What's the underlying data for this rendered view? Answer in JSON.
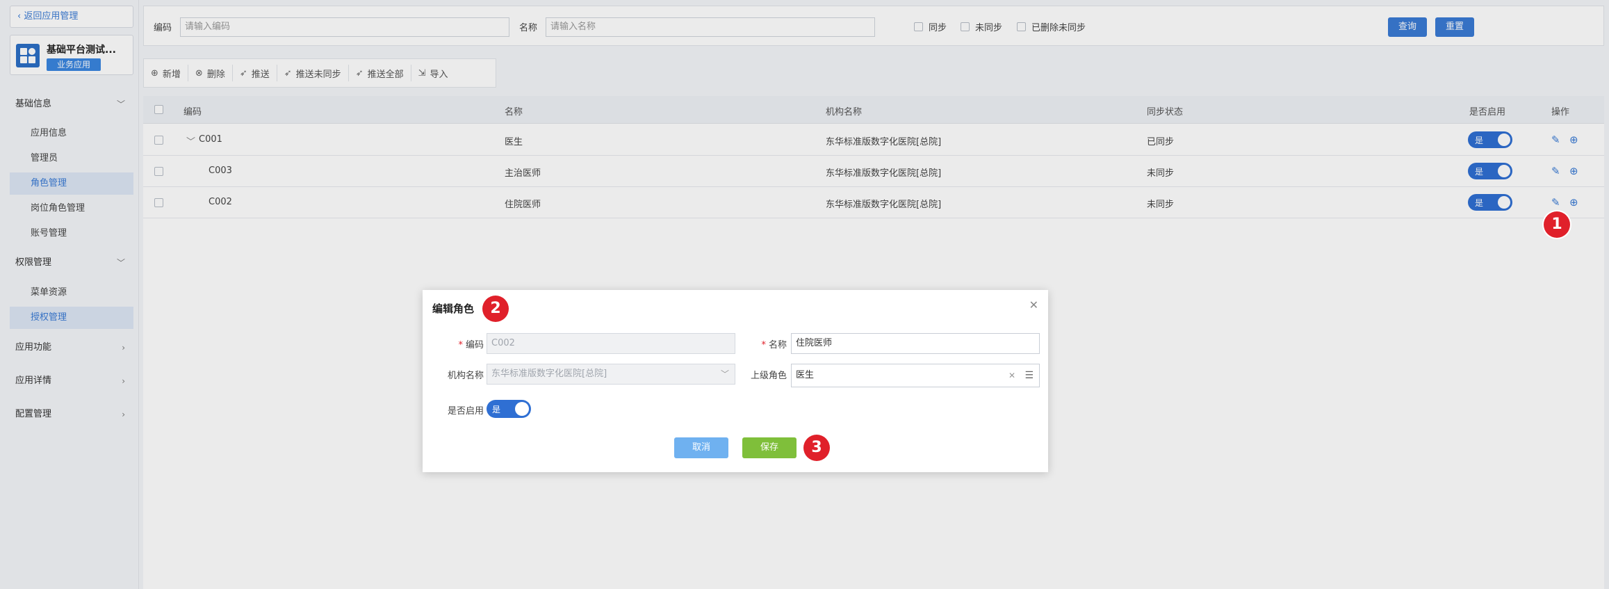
{
  "sidebar": {
    "back_label": "返回应用管理",
    "app_name": "基础平台测试...",
    "app_tag": "业务应用",
    "groups": [
      {
        "label": "基础信息",
        "items": [
          "应用信息",
          "管理员",
          "角色管理",
          "岗位角色管理",
          "账号管理"
        ]
      },
      {
        "label": "权限管理",
        "items": [
          "菜单资源",
          "授权管理"
        ]
      },
      {
        "label": "应用功能",
        "items": []
      },
      {
        "label": "应用详情",
        "items": []
      },
      {
        "label": "配置管理",
        "items": []
      }
    ]
  },
  "search": {
    "code_label": "编码",
    "code_placeholder": "请输入编码",
    "name_label": "名称",
    "name_placeholder": "请输入名称",
    "filters": [
      "同步",
      "未同步",
      "已删除未同步"
    ],
    "query_label": "查询",
    "reset_label": "重置"
  },
  "toolbar": [
    "新增",
    "删除",
    "推送",
    "推送未同步",
    "推送全部",
    "导入"
  ],
  "table": {
    "headers": [
      "编码",
      "名称",
      "机构名称",
      "同步状态",
      "是否启用",
      "操作"
    ],
    "rows": [
      {
        "code": "C001",
        "name": "医生",
        "org": "东华标准版数字化医院[总院]",
        "sync": "已同步",
        "enabled": "是"
      },
      {
        "code": "C003",
        "name": "主治医师",
        "org": "东华标准版数字化医院[总院]",
        "sync": "未同步",
        "enabled": "是"
      },
      {
        "code": "C002",
        "name": "住院医师",
        "org": "东华标准版数字化医院[总院]",
        "sync": "未同步",
        "enabled": "是"
      }
    ]
  },
  "badges": [
    "1",
    "2",
    "3"
  ],
  "dialog": {
    "title": "编辑角色",
    "code_label": "编码",
    "code_value": "C002",
    "name_label": "名称",
    "name_value": "住院医师",
    "org_label": "机构名称",
    "org_value": "东华标准版数字化医院[总院]",
    "parent_label": "上级角色",
    "parent_value": "医生",
    "enabled_label": "是否启用",
    "enabled_value": "是",
    "cancel_label": "取消",
    "save_label": "保存"
  }
}
